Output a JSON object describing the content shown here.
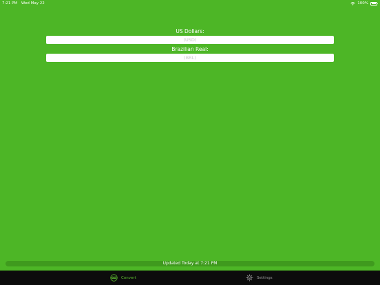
{
  "status_bar": {
    "time": "7:21 PM",
    "date": "Wed May 22",
    "battery_percent": "100%",
    "icons": [
      "wifi-icon",
      "battery-icon"
    ]
  },
  "converter": {
    "usd_label": "US Dollars:",
    "usd_placeholder": "(USD)",
    "brl_label": "Brazilian Real:",
    "brl_placeholder": "(BRL)"
  },
  "update_status": "Updated Today at 7:21 PM",
  "tab_bar": {
    "convert_label": "Convert",
    "settings_label": "Settings",
    "convert_icon": "convert-icon",
    "settings_icon": "gear-icon"
  },
  "colors": {
    "background": "#4db626",
    "update_bar": "#3f9a1e",
    "tab_bar": "#0c0c0c",
    "active_tab": "#5fc030",
    "inactive_tab": "#9a9a9a"
  }
}
